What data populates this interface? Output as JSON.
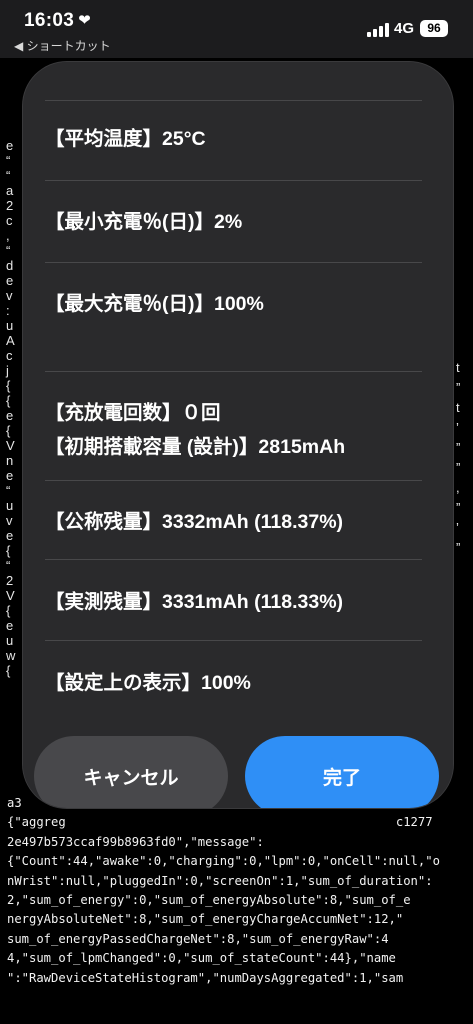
{
  "status_bar": {
    "time": "16:03",
    "back_label": "◀ ショートカット",
    "network": "4G",
    "battery": "96"
  },
  "sheet": {
    "rows": [
      {
        "label": "【平均温度】25°C"
      },
      {
        "label": "【最小充電％(日)】2%"
      },
      {
        "label": "【最大充電％(日)】100%"
      },
      {
        "label": "【充放電回数】０回"
      },
      {
        "label": "【初期搭載容量 (設計)】2815mAh"
      },
      {
        "label": "【公称残量】3332mAh (118.37%)"
      },
      {
        "label": "【実測残量】3331mAh (118.33%)"
      },
      {
        "label": "【設定上の表示】100%"
      }
    ],
    "cancel_label": "キャンセル",
    "done_label": "完了"
  },
  "log": {
    "lines": [
      "a3",
      "{\"aggreg                                             c1277",
      "2e497b573ccaf99b8963fd0\",\"message\":",
      "{\"Count\":44,\"awake\":0,\"charging\":0,\"lpm\":0,\"onCell\":null,\"o",
      "nWrist\":null,\"pluggedIn\":0,\"screenOn\":1,\"sum_of_duration\":",
      "2,\"sum_of_energy\":0,\"sum_of_energyAbsolute\":8,\"sum_of_e",
      "nergyAbsoluteNet\":8,\"sum_of_energyChargeAccumNet\":12,\"",
      "sum_of_energyPassedChargeNet\":8,\"sum_of_energyRaw\":4",
      "4,\"sum_of_lpmChanged\":0,\"sum_of_stateCount\":44},\"name",
      "\":\"RawDeviceStateHistogram\",\"numDaysAggregated\":1,\"sam"
    ],
    "gutter": "e\n“\n“\na\n2\nc\n,\n“\nd\ne\nv\n:\nu\nA\nc\nj\n{\n{\ne\n{\nV\nn\ne\n“\nu\nv\ne\n{\n“\n2\nV\n{\ne\nu\nw\n{",
    "right": "t\n”\nt\n’\n”\n”\n,\n”\n’\n”"
  }
}
